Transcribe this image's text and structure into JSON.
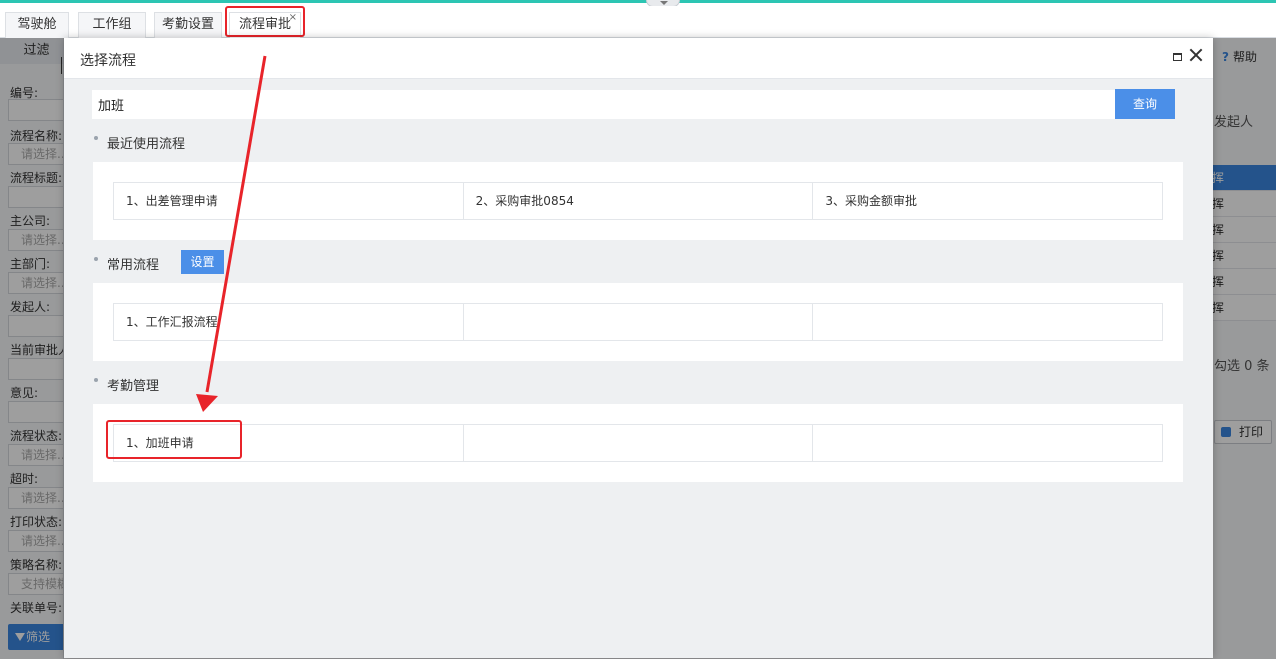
{
  "tabs": [
    {
      "label": "驾驶舱"
    },
    {
      "label": "工作组"
    },
    {
      "label": "考勤设置"
    },
    {
      "label": "流程审批",
      "close": "×"
    }
  ],
  "left_panel": {
    "header": "过滤",
    "fields": [
      {
        "label": "编号:",
        "placeholder": ""
      },
      {
        "label": "流程名称:",
        "placeholder": "请选择..."
      },
      {
        "label": "流程标题:",
        "placeholder": ""
      },
      {
        "label": "主公司:",
        "placeholder": "请选择..."
      },
      {
        "label": "主部门:",
        "placeholder": "请选择..."
      },
      {
        "label": "发起人:",
        "placeholder": ""
      },
      {
        "label": "当前审批人",
        "placeholder": ""
      },
      {
        "label": "意见:",
        "placeholder": ""
      },
      {
        "label": "流程状态:",
        "placeholder": "请选择..."
      },
      {
        "label": "超时:",
        "placeholder": "请选择..."
      },
      {
        "label": "打印状态:",
        "placeholder": "请选择..."
      },
      {
        "label": "策略名称:",
        "placeholder": "支持模糊"
      },
      {
        "label": "关联单号:",
        "placeholder": ""
      }
    ],
    "filter_button": "筛选"
  },
  "right_panel": {
    "help": "帮助",
    "help_icon": "?",
    "column_header": "发起人",
    "rows": [
      "挥",
      "挥",
      "挥",
      "挥",
      "挥",
      "挥"
    ],
    "selected_count": "勾选 0 条",
    "print": "打印"
  },
  "modal": {
    "title": "选择流程",
    "search": {
      "value": "加班",
      "button": "查询"
    },
    "sections": [
      {
        "title": "最近使用流程",
        "items": [
          "1、出差管理申请",
          "2、采购审批0854",
          "3、采购金额审批"
        ]
      },
      {
        "title": "常用流程",
        "settings_button": "设置",
        "items": [
          "1、工作汇报流程",
          "",
          ""
        ]
      },
      {
        "title": "考勤管理",
        "items": [
          "1、加班申请",
          "",
          ""
        ]
      }
    ]
  },
  "colors": {
    "accent_blue": "#4b8fe8",
    "highlight_red": "#e8242a",
    "top_strip": "#2cc5b3"
  }
}
